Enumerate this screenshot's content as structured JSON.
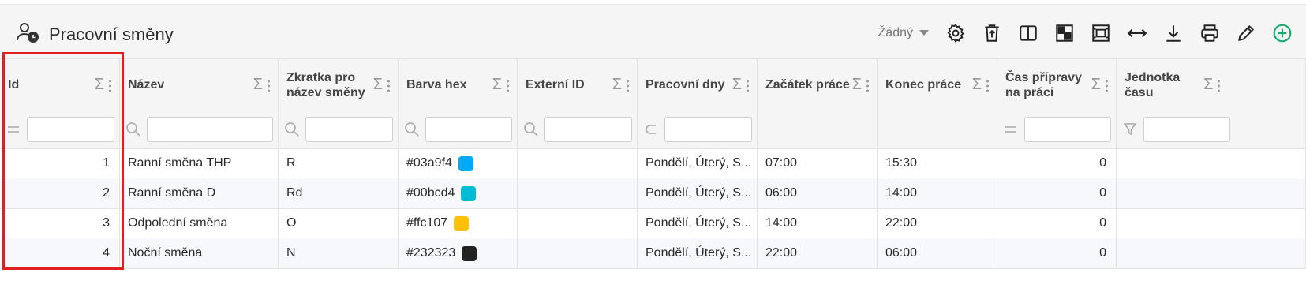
{
  "page": {
    "title": "Pracovní směny"
  },
  "toolbar": {
    "select_value": "Žádný",
    "icons": [
      "gear-icon",
      "trash-upload-icon",
      "columns-icon",
      "layout-icon",
      "frame-icon",
      "resize-horizontal-icon",
      "download-icon",
      "print-icon",
      "pencil-icon",
      "add-circle-icon"
    ],
    "add_color": "#1aaa6e"
  },
  "columns": [
    {
      "label": "Id"
    },
    {
      "label": "Název"
    },
    {
      "label": "Zkratka pro název směny"
    },
    {
      "label": "Barva hex"
    },
    {
      "label": "Externí ID"
    },
    {
      "label": "Pracovní dny"
    },
    {
      "label": "Začátek práce"
    },
    {
      "label": "Konec práce"
    },
    {
      "label": "Čas přípravy na práci"
    },
    {
      "label": "Jednotka času"
    }
  ],
  "sigma": "Σ",
  "rows": [
    {
      "id": "1",
      "nazev": "Ranní směna THP",
      "zkratka": "R",
      "barva": "#03a9f4",
      "externi": "",
      "dny": "Pondělí, Úterý, S...",
      "zacatek": "07:00",
      "konec": "15:30",
      "priprava": "0",
      "jednotka": ""
    },
    {
      "id": "2",
      "nazev": "Ranní směna D",
      "zkratka": "Rd",
      "barva": "#00bcd4",
      "externi": "",
      "dny": "Pondělí, Úterý, S...",
      "zacatek": "06:00",
      "konec": "14:00",
      "priprava": "0",
      "jednotka": ""
    },
    {
      "id": "3",
      "nazev": "Odpolední směna",
      "zkratka": "O",
      "barva": "#ffc107",
      "externi": "",
      "dny": "Pondělí, Úterý, S...",
      "zacatek": "14:00",
      "konec": "22:00",
      "priprava": "0",
      "jednotka": ""
    },
    {
      "id": "4",
      "nazev": "Noční směna",
      "zkratka": "N",
      "barva": "#232323",
      "externi": "",
      "dny": "Pondělí, Úterý, S...",
      "zacatek": "22:00",
      "konec": "06:00",
      "priprava": "0",
      "jednotka": ""
    }
  ],
  "highlight_color": "#e02020"
}
